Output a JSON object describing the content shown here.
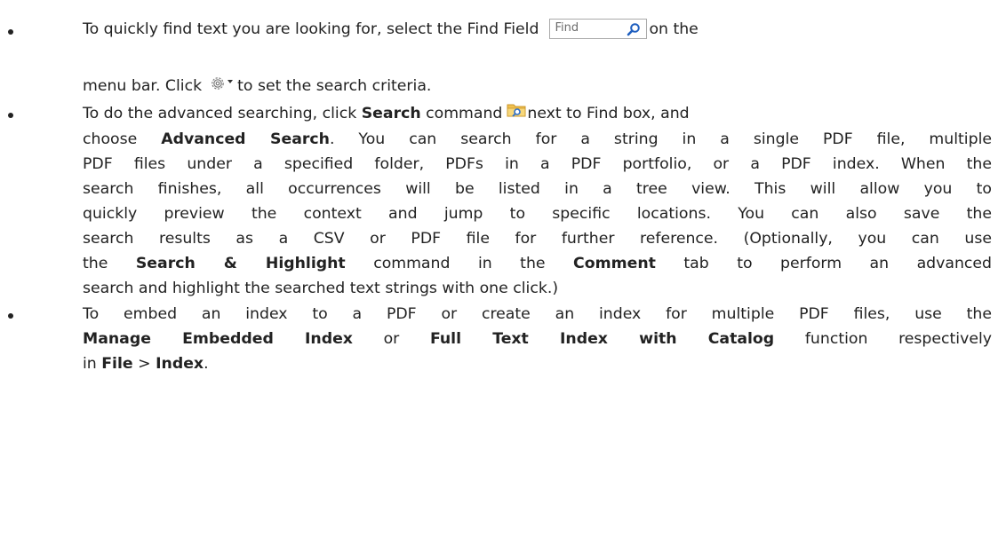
{
  "bullets": [
    {
      "seg1": "To quickly find text you are looking for, select the Find Field",
      "find_placeholder": "Find",
      "seg2": "on the",
      "seg3": "menu bar. Click",
      "seg4": "to set the search criteria."
    },
    {
      "l1a": "To do the advanced searching, click ",
      "l1b": "Search",
      "l1c": " command",
      "l1d": "next to Find box, and",
      "l2a": "choose ",
      "l2b": "Advanced Search",
      "l2c": ". You can search for a string in a single PDF file, multiple",
      "l3": "PDF files under a specified folder, PDFs in a PDF portfolio, or a PDF index. When the",
      "l4": "search finishes, all occurrences will be listed in a tree view. This will allow you to",
      "l5": "quickly preview the context and jump to specific locations. You can also save the",
      "l6": "search results as a CSV or PDF file for further reference. (Optionally, you can use",
      "l7a": "the ",
      "l7b": "Search & Highlight",
      "l7c": " command in the ",
      "l7d": "Comment",
      "l7e": " tab to perform an advanced",
      "l8": "search and highlight the searched text strings with one click.)"
    },
    {
      "l1": "To embed an index to a PDF or create an index for multiple PDF files, use the",
      "l2a": "Manage Embedded Index",
      "l2b": " or ",
      "l2c": "Full Text Index with Catalog",
      "l2d": " function respectively",
      "l3a": "in ",
      "l3b": "File",
      "l3c": " > ",
      "l3d": "Index",
      "l3e": "."
    }
  ]
}
